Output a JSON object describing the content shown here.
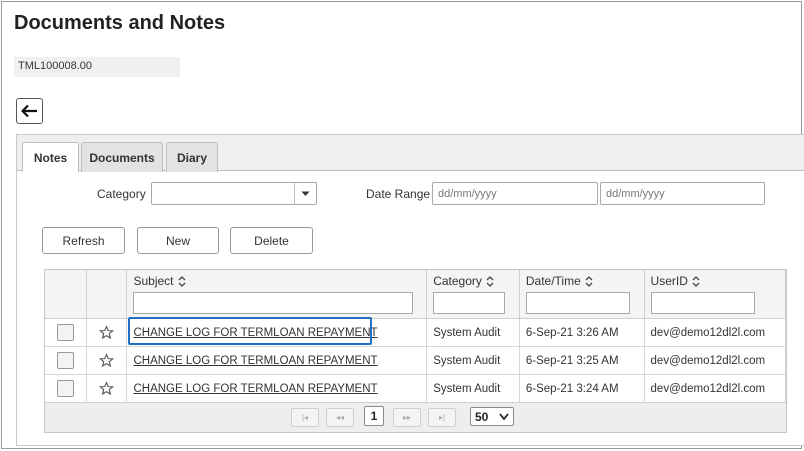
{
  "page": {
    "title": "Documents and Notes",
    "reference": "TML100008.00"
  },
  "tabs": [
    {
      "label": "Notes",
      "active": true
    },
    {
      "label": "Documents",
      "active": false
    },
    {
      "label": "Diary",
      "active": false
    }
  ],
  "filters": {
    "category_label": "Category",
    "category_value": "",
    "date_range_label": "Date Range",
    "date_from_placeholder": "dd/mm/yyyy",
    "date_to_placeholder": "dd/mm/yyyy"
  },
  "actions": {
    "refresh": "Refresh",
    "new": "New",
    "delete": "Delete"
  },
  "grid": {
    "columns": [
      "Subject",
      "Category",
      "Date/Time",
      "UserID"
    ],
    "rows": [
      {
        "subject": "CHANGE LOG FOR TERMLOAN REPAYMENT",
        "category": "System Audit",
        "datetime": "6-Sep-21 3:26 AM",
        "userid": "dev@demo12dl2l.com"
      },
      {
        "subject": "CHANGE LOG FOR TERMLOAN REPAYMENT",
        "category": "System Audit",
        "datetime": "6-Sep-21 3:25 AM",
        "userid": "dev@demo12dl2l.com"
      },
      {
        "subject": "CHANGE LOG FOR TERMLOAN REPAYMENT",
        "category": "System Audit",
        "datetime": "6-Sep-21 3:24 AM",
        "userid": "dev@demo12dl2l.com"
      }
    ]
  },
  "pager": {
    "current_page": "1",
    "page_size": "50"
  },
  "colors": {
    "highlight": "#1f6fc5"
  }
}
